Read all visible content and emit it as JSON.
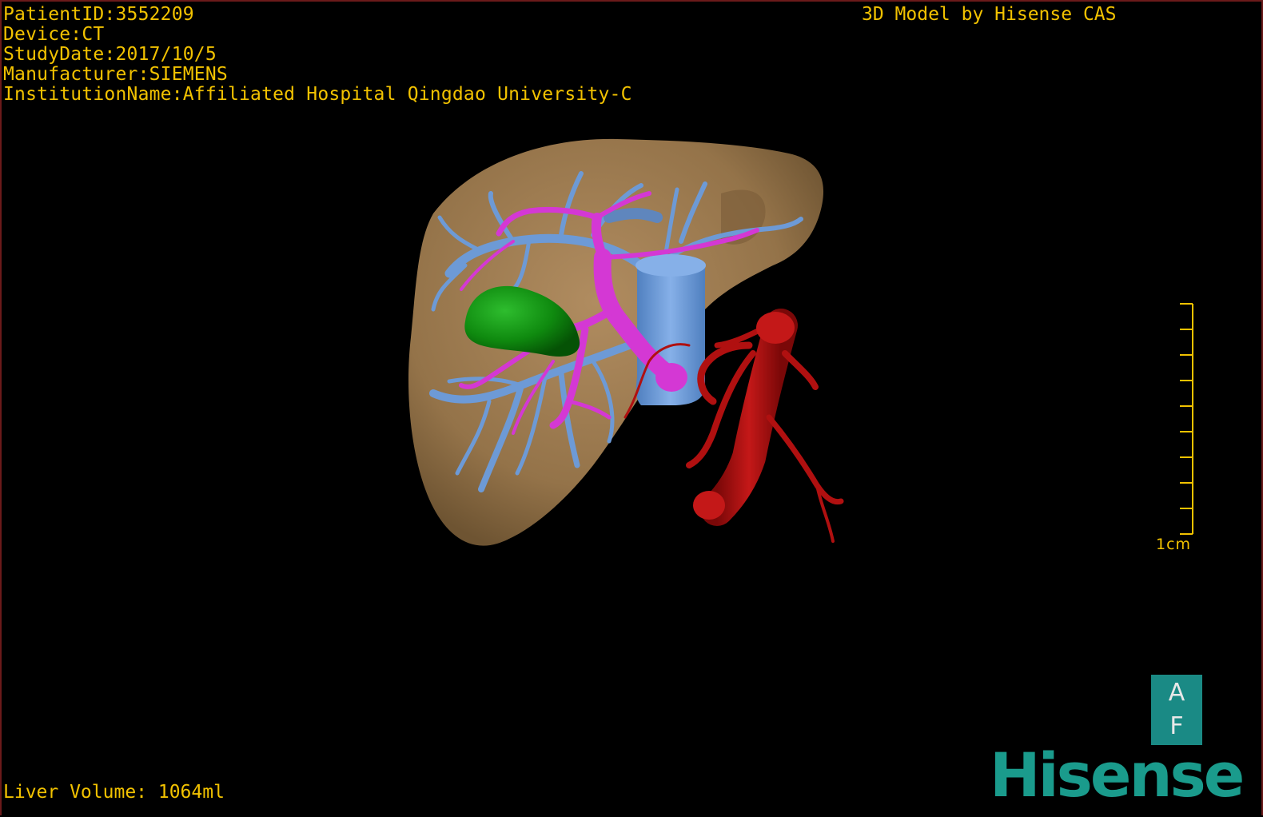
{
  "patient_info": {
    "patient_id": "PatientID:3552209",
    "device": "Device:CT",
    "study_date": "StudyDate:2017/10/5",
    "manufacturer": "Manufacturer:SIEMENS",
    "institution": "InstitutionName:Affiliated Hospital Qingdao University-C"
  },
  "credit": "3D Model by Hisense CAS",
  "liver_volume": "Liver Volume: 1064ml",
  "scale_bar": {
    "label": "1cm",
    "color": "#f2c200"
  },
  "orientation": {
    "top": "A",
    "bottom": "F",
    "color": "#1a8a85"
  },
  "brand": {
    "name": "Hisense",
    "color": "#1a9b8c"
  },
  "model_colors": {
    "liver": "#9c7a52",
    "hepatic_vein": "#6d9ad6",
    "portal_vein": "#d438d4",
    "gallbladder": "#0f8a0f",
    "artery": "#b01010"
  }
}
